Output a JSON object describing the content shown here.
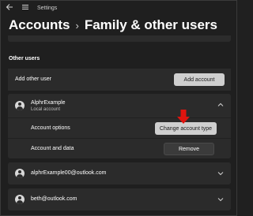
{
  "window": {
    "app_title": "Settings",
    "back_icon": "back-arrow-icon",
    "menu_icon": "hamburger-menu-icon"
  },
  "breadcrumb": {
    "parent": "Accounts",
    "separator": "›",
    "current": "Family & other users"
  },
  "other_users": {
    "title": "Other users",
    "add_row": {
      "label": "Add other user",
      "button_label": "Add account"
    },
    "expanded_user": {
      "name": "AlphrExample",
      "type": "Local account",
      "options_label": "Account options",
      "change_type_button": "Change account type",
      "data_label": "Account and data",
      "remove_button": "Remove"
    },
    "collapsed_users": [
      {
        "name": "alphrExample00@outlook.com"
      },
      {
        "name": "beth@outlook.com"
      }
    ]
  },
  "colors": {
    "background": "#202020",
    "card": "#2b2b2b",
    "highlight_arrow": "#e0140f",
    "button_light": "#cfcfcf"
  }
}
